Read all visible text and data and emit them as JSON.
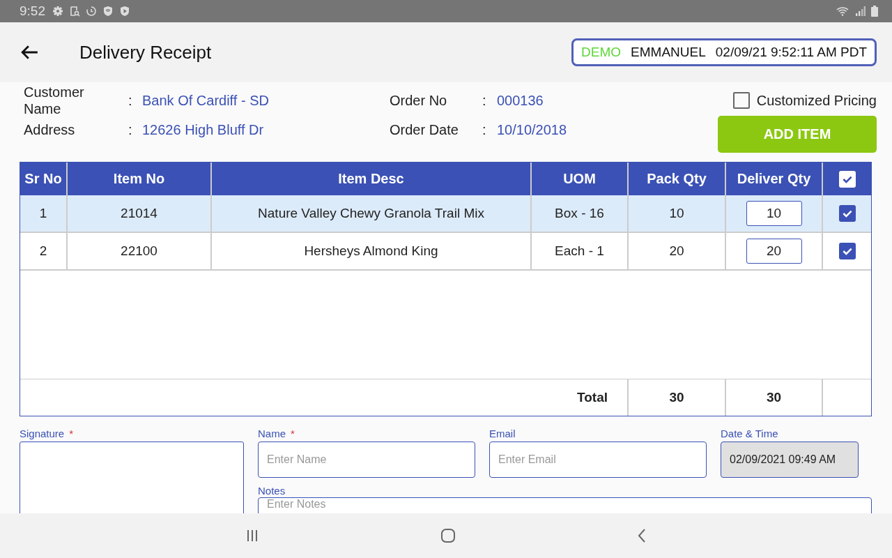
{
  "status_bar": {
    "time": "9:52"
  },
  "header": {
    "title": "Delivery Receipt",
    "session": {
      "mode": "DEMO",
      "user": "EMMANUEL",
      "datetime": "02/09/21 9:52:11 AM PDT"
    }
  },
  "order_info": [
    {
      "label": "Customer Name",
      "separator": ":",
      "value": "Bank Of Cardiff - SD"
    },
    {
      "label": "Order No",
      "separator": ":",
      "value": "000136"
    },
    {
      "label": "Address",
      "separator": ":",
      "value": "12626 High Bluff Dr"
    },
    {
      "label": "Order Date",
      "separator": ":",
      "value": "10/10/2018"
    }
  ],
  "customized_pricing": {
    "label": "Customized Pricing",
    "checked": false
  },
  "add_item_button": "ADD ITEM",
  "table": {
    "columns": [
      "Sr No",
      "Item No",
      "Item Desc",
      "UOM",
      "Pack Qty",
      "Deliver Qty"
    ],
    "header_checked": true,
    "rows": [
      {
        "sr_no": "1",
        "item_no": "21014",
        "item_desc": "Nature Valley Chewy Granola Trail Mix",
        "uom": "Box - 16",
        "pack_qty": "10",
        "deliver_qty": "10",
        "checked": true,
        "selected": true
      },
      {
        "sr_no": "2",
        "item_no": "22100",
        "item_desc": "Hersheys Almond King",
        "uom": "Each - 1",
        "pack_qty": "20",
        "deliver_qty": "20",
        "checked": true,
        "selected": false
      }
    ],
    "total": {
      "label": "Total",
      "pack_qty": "30",
      "deliver_qty": "30"
    }
  },
  "form": {
    "required_mark": "*",
    "signature": {
      "label": "Signature",
      "required": true
    },
    "name": {
      "label": "Name",
      "required": true,
      "placeholder": "Enter Name"
    },
    "email": {
      "label": "Email",
      "required": false,
      "placeholder": "Enter Email"
    },
    "date_time": {
      "label": "Date & Time",
      "value": "02/09/2021 09:49 AM"
    },
    "notes": {
      "label": "Notes",
      "placeholder": "Enter Notes"
    }
  }
}
